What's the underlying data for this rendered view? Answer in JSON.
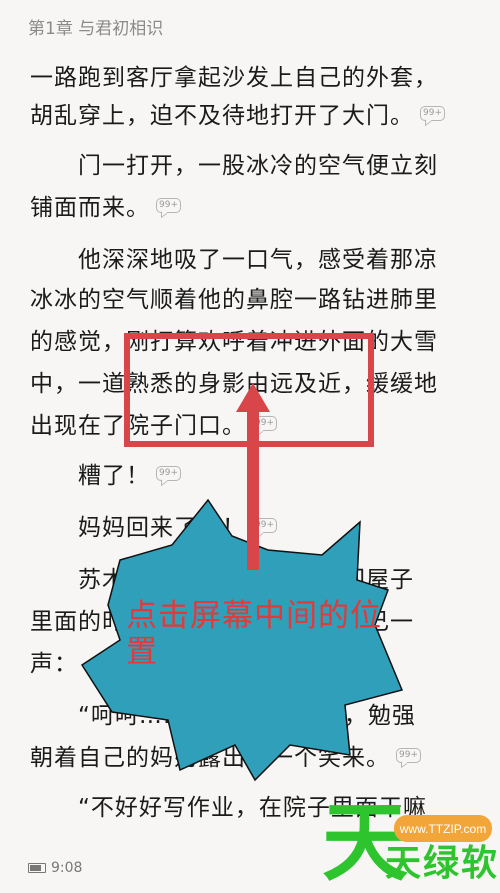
{
  "chapter_title": "第1章 与君初相识",
  "comment_badge": "99+",
  "lines": [
    "一路跑到客厅拿起沙发上自己的外套，",
    "胡乱穿上，迫不及待地打开了大门。",
    "门一打开，一股冰冷的空气便立刻",
    "铺面而来。",
    "他深深地吸了一口气，感受着那凉",
    "冰冰的空气顺着他的鼻腔一路钻进肺里",
    "的感觉，刚打算欢呼着冲进外面的大雪",
    "中，一道熟悉的身影由远及近，缓缓地",
    "出现在了院子门口。",
    "糟了！",
    "妈妈回来了！！",
    "苏木回过神来，刚要转身回屋子",
    "里面的时候，就听到妈妈叫了自己一",
    "声：",
    "“呵呵……”苏木转过身来，勉强",
    "朝着自己的妈妈露出了一个笑来。",
    "“不好好写作业，在院子里面干嘛"
  ],
  "callout": {
    "text": "点击屏幕中间的位置",
    "fill_color": "#2f9fba",
    "highlight_color": "#d9464a"
  },
  "status": {
    "time": "9:08"
  },
  "watermark": {
    "url": "www.TTZIP.com",
    "big_char": "天",
    "small_text": "天绿软",
    "brand_color": "#2ec42e",
    "badge_color": "#f2a63a"
  }
}
